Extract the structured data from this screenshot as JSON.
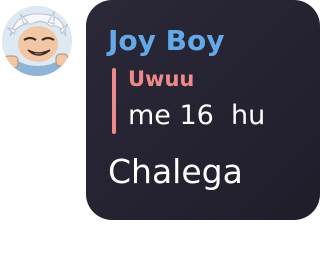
{
  "message": {
    "avatar_icon": "user-avatar-anime-character",
    "sender_name": "Joy Boy",
    "sender_color": "#63a9e9",
    "reply": {
      "author": "Uwuu",
      "author_color": "#ef8a8a",
      "bar_color": "#ef8a8a",
      "text": "me 16  hu"
    },
    "text": "Chalega",
    "bubble_color": "#25222f"
  }
}
